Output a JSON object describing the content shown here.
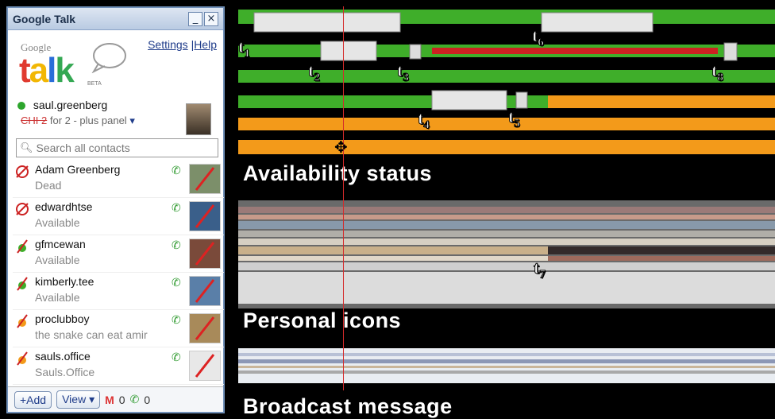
{
  "gtalk": {
    "title": "Google Talk",
    "minimize_glyph": "_",
    "close_glyph": "×",
    "logo_small": "Google",
    "logo_big": "talk",
    "logo_beta": "BETA",
    "settings_link": "Settings",
    "help_link": "|Help",
    "me": {
      "name": "saul.greenberg",
      "status_strike": "CHI 2",
      "status_rest": "for 2 - plus panel",
      "status_color": "#2da52d"
    },
    "search_placeholder": "Search all contacts",
    "contacts": [
      {
        "name": "Adam Greenberg",
        "status": "Dead"
      },
      {
        "name": "edwardhtse",
        "status": "Available"
      },
      {
        "name": "gfmcewan",
        "status": "Available"
      },
      {
        "name": "kimberly.tee",
        "status": "Available"
      },
      {
        "name": "proclubboy",
        "status": "the snake can eat amir"
      },
      {
        "name": "sauls.office",
        "status": "Sauls.Office"
      }
    ],
    "bottom": {
      "add_label": "+Add",
      "view_label": "View ▾",
      "mail_count": "0",
      "phone_count": "0"
    }
  },
  "viz": {
    "sections": {
      "availability": "Availability status",
      "icons": "Personal icons",
      "broadcast": "Broadcast message"
    },
    "time_markers": [
      "1",
      "2",
      "3",
      "4",
      "5",
      "6",
      "7",
      "8"
    ]
  },
  "colors": {
    "available": "#3fae2a",
    "away": "#f39a1a",
    "offline": "#d9d9d9",
    "busy": "#cc2222",
    "cursor": "#d42b2b"
  }
}
